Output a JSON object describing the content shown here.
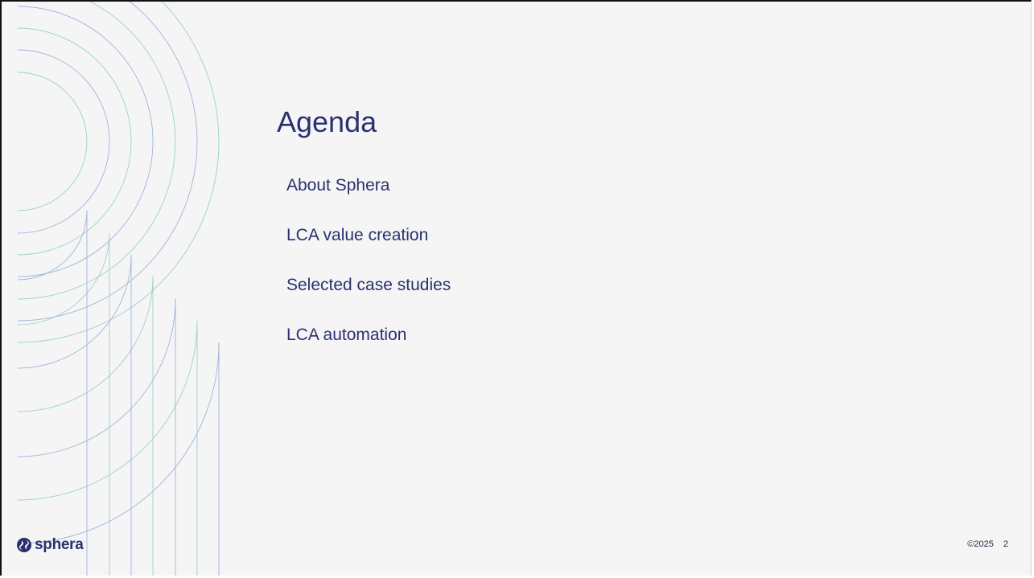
{
  "slide": {
    "title": "Agenda",
    "agenda_items": [
      "About Sphera",
      "LCA value creation",
      "Selected case studies",
      "LCA automation"
    ],
    "footer": {
      "copyright": "©2025",
      "page_number": "2"
    },
    "logo": {
      "text": "sphera",
      "trademark": "·"
    }
  },
  "colors": {
    "background": "#f5f5f5",
    "text_primary": "#2a3170",
    "decor_blue": "#9fb4dc",
    "decor_teal": "#9ad2cc"
  },
  "icons": [
    "sphera-logo-icon",
    "decorative-arcs"
  ]
}
